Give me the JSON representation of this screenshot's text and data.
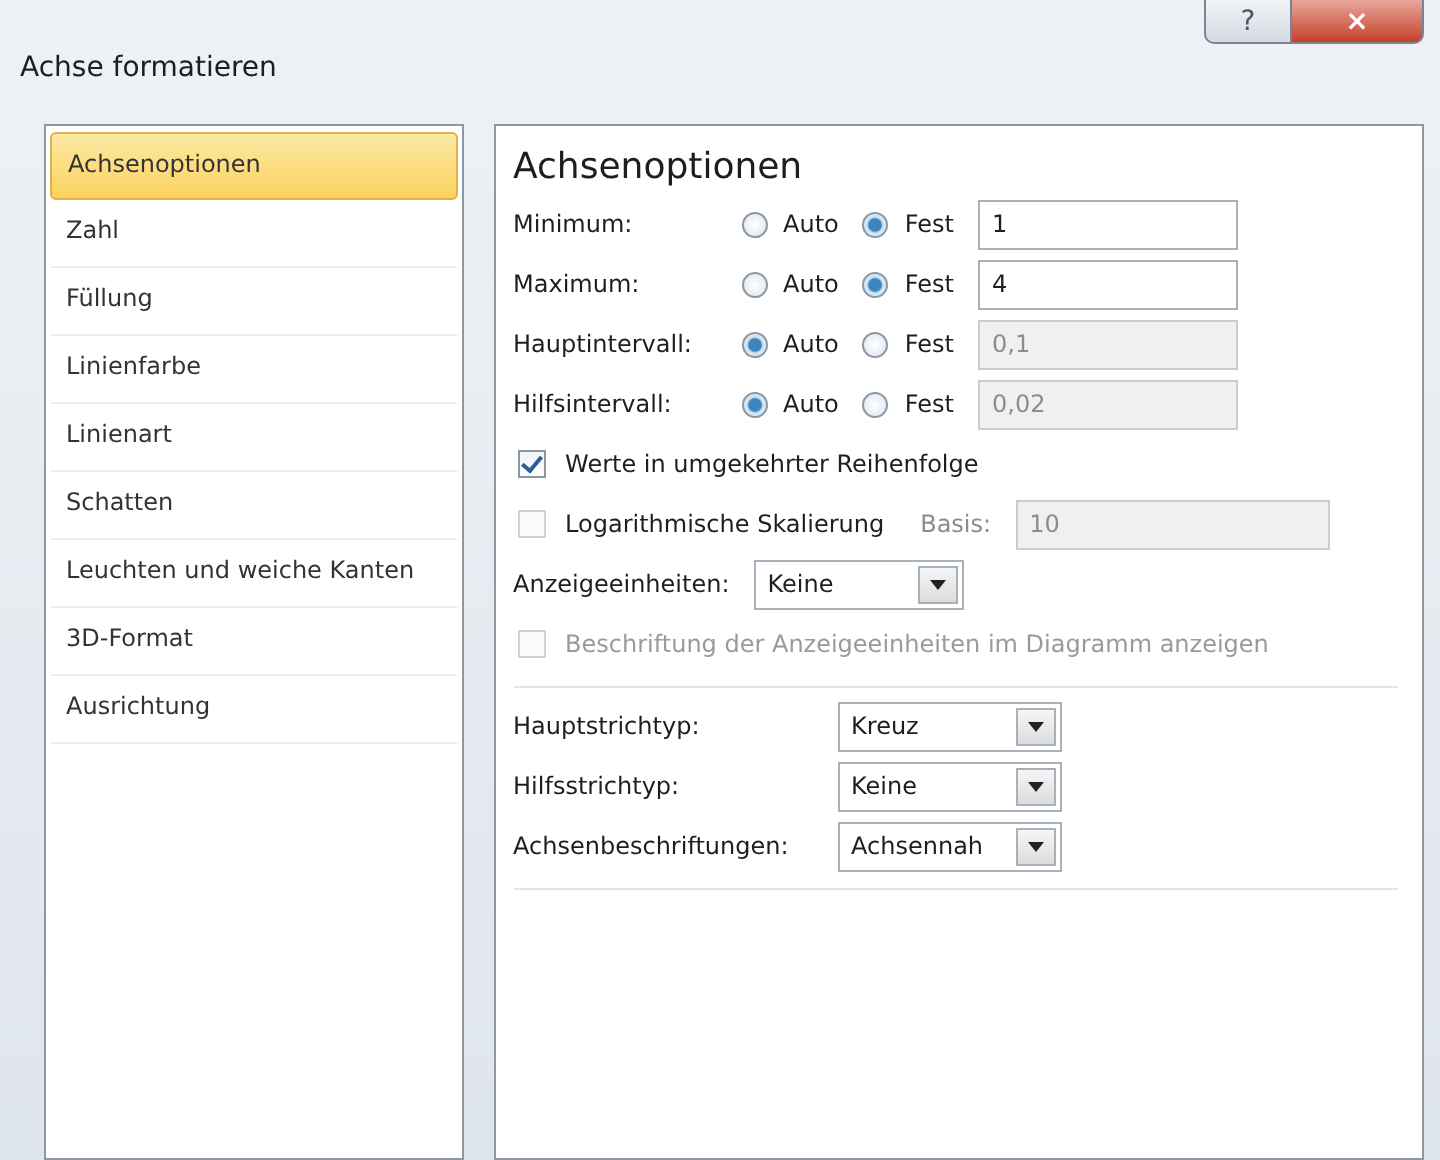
{
  "window": {
    "title": "Achse formatieren",
    "help_label": "?",
    "close_label": "×"
  },
  "sidebar": {
    "items": [
      {
        "label": "Achsenoptionen",
        "selected": true
      },
      {
        "label": "Zahl",
        "selected": false
      },
      {
        "label": "Füllung",
        "selected": false
      },
      {
        "label": "Linienfarbe",
        "selected": false
      },
      {
        "label": "Linienart",
        "selected": false
      },
      {
        "label": "Schatten",
        "selected": false
      },
      {
        "label": "Leuchten und weiche Kanten",
        "selected": false
      },
      {
        "label": "3D-Format",
        "selected": false
      },
      {
        "label": "Ausrichtung",
        "selected": false
      }
    ]
  },
  "panel": {
    "heading": "Achsenoptionen",
    "rows": [
      {
        "kind": "radio",
        "label": "Minimum:",
        "options": [
          {
            "label": "Auto",
            "selected": false
          },
          {
            "label": "Fest",
            "selected": true
          }
        ],
        "value": "1",
        "disabled": false
      },
      {
        "kind": "radio",
        "label": "Maximum:",
        "options": [
          {
            "label": "Auto",
            "selected": false
          },
          {
            "label": "Fest",
            "selected": true
          }
        ],
        "value": "4",
        "disabled": false
      },
      {
        "kind": "radio",
        "label": "Hauptintervall:",
        "options": [
          {
            "label": "Auto",
            "selected": true
          },
          {
            "label": "Fest",
            "selected": false
          }
        ],
        "value": "0,1",
        "disabled": true
      },
      {
        "kind": "radio",
        "label": "Hilfsintervall:",
        "options": [
          {
            "label": "Auto",
            "selected": true
          },
          {
            "label": "Fest",
            "selected": false
          }
        ],
        "value": "0,02",
        "disabled": true
      },
      {
        "kind": "checkbox",
        "label": "Werte in umgekehrter Reihenfolge",
        "checked": true,
        "disabled": false
      },
      {
        "kind": "checkbox-field",
        "label": "Logarithmische Skalierung",
        "checked": false,
        "field_label": "Basis:",
        "value": "10",
        "disabled": true
      },
      {
        "kind": "dropdown",
        "label": "Anzeigeeinheiten:",
        "value": "Keine"
      },
      {
        "kind": "checkbox",
        "label": "Beschriftung der Anzeigeeinheiten im Diagramm anzeigen",
        "checked": false,
        "disabled": true
      },
      {
        "kind": "separator"
      },
      {
        "kind": "dropdown-wide",
        "label": "Hauptstrichtyp:",
        "value": "Kreuz"
      },
      {
        "kind": "dropdown-wide",
        "label": "Hilfsstrichtyp:",
        "value": "Keine"
      },
      {
        "kind": "dropdown-wide",
        "label": "Achsenbeschriftungen:",
        "value": "Achsennah"
      },
      {
        "kind": "separator"
      }
    ]
  }
}
